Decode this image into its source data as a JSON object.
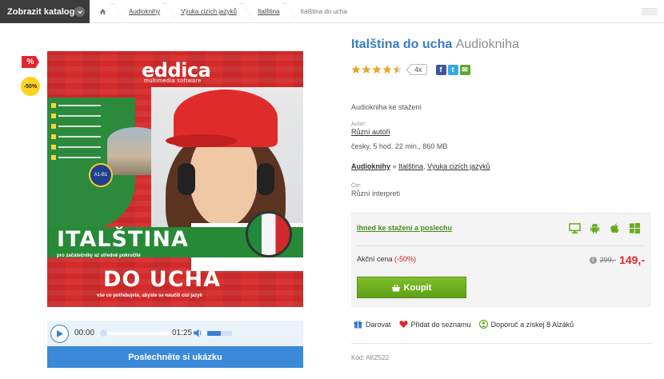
{
  "topbar": {
    "catalog_button": "Zobrazit katalog",
    "breadcrumbs": [
      {
        "label": "Audioknihy"
      },
      {
        "label": "Výuka cizích jazyků"
      },
      {
        "label": "Italština"
      }
    ],
    "current": "Italština do ucha"
  },
  "badges": {
    "percent_icon": "%",
    "discount": "-50%"
  },
  "cover": {
    "logo": "eddica",
    "logo_sub": "multimedia software",
    "level_seal": "A1-B1",
    "title_line1": "ITALŠTINA",
    "subtitle1": "pro začátečníky až středně pokročilé",
    "title_line2": "DO UCHA",
    "subtitle2": "vše co potřebujete, abyste se naučili cizí jazyk"
  },
  "player": {
    "time_current": "00:00",
    "time_total": "01:25",
    "volume_level": 0.55,
    "progress": 0,
    "listen_button": "Poslechněte si ukázku"
  },
  "product": {
    "title": "Italština do ucha",
    "type": "Audiokniha",
    "rating": 4.5,
    "rating_count": "4x",
    "description": "Audiokniha ke stažení",
    "author_label": "Autor:",
    "author": "Různí autoři",
    "meta": "česky, 5 hod. 22 min., 860 MB",
    "category_main": "Audioknihy",
    "category_sep": "»",
    "category_sub1": "Italština",
    "category_sub2": "Výuka cizích jazyků",
    "reader_label": "Čte:",
    "reader": "Různí interpreti"
  },
  "buybox": {
    "availability": "Ihned ke stažení a poslechu",
    "platforms": [
      "desktop-icon",
      "android-icon",
      "apple-icon",
      "windows-icon"
    ],
    "price_label": "Akční cena",
    "price_pct": "(-50%)",
    "old_price": "299,-",
    "new_price": "149,-",
    "buy_button": "Koupit"
  },
  "actions": {
    "gift": "Darovat",
    "wishlist": "Přidat do seznamu",
    "recommend": "Doporuč a získej 8 Alzáků"
  },
  "code": "Kód: AKZ522",
  "colors": {
    "accent_blue": "#3a7cc4",
    "price_red": "#e3262e",
    "buy_green": "#6aab1e"
  }
}
